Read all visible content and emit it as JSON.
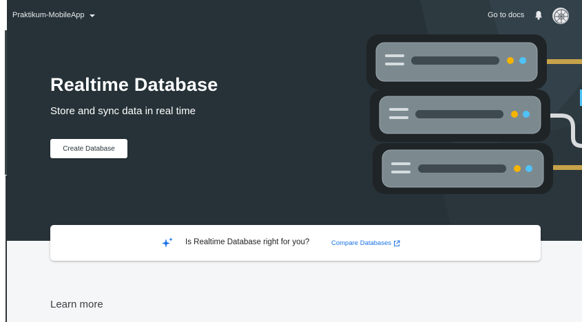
{
  "topbar": {
    "project_name": "Praktikum-MobileApp",
    "docs_link": "Go to docs"
  },
  "hero": {
    "title": "Realtime Database",
    "subtitle": "Store and sync data in real time",
    "create_button": "Create Database"
  },
  "compare": {
    "question": "Is Realtime Database right for you?",
    "link": "Compare Databases"
  },
  "learn_more": "Learn more",
  "colors": {
    "hero_bg": "#263238",
    "page_bg": "#f5f6f7",
    "accent_link": "#1a73e8",
    "server_yellow": "#f4b400",
    "server_cyan": "#4fc3f7"
  },
  "icons": [
    "bell-icon",
    "avatar",
    "sparkle-icon",
    "external-link-icon",
    "chevron-down-icon"
  ]
}
